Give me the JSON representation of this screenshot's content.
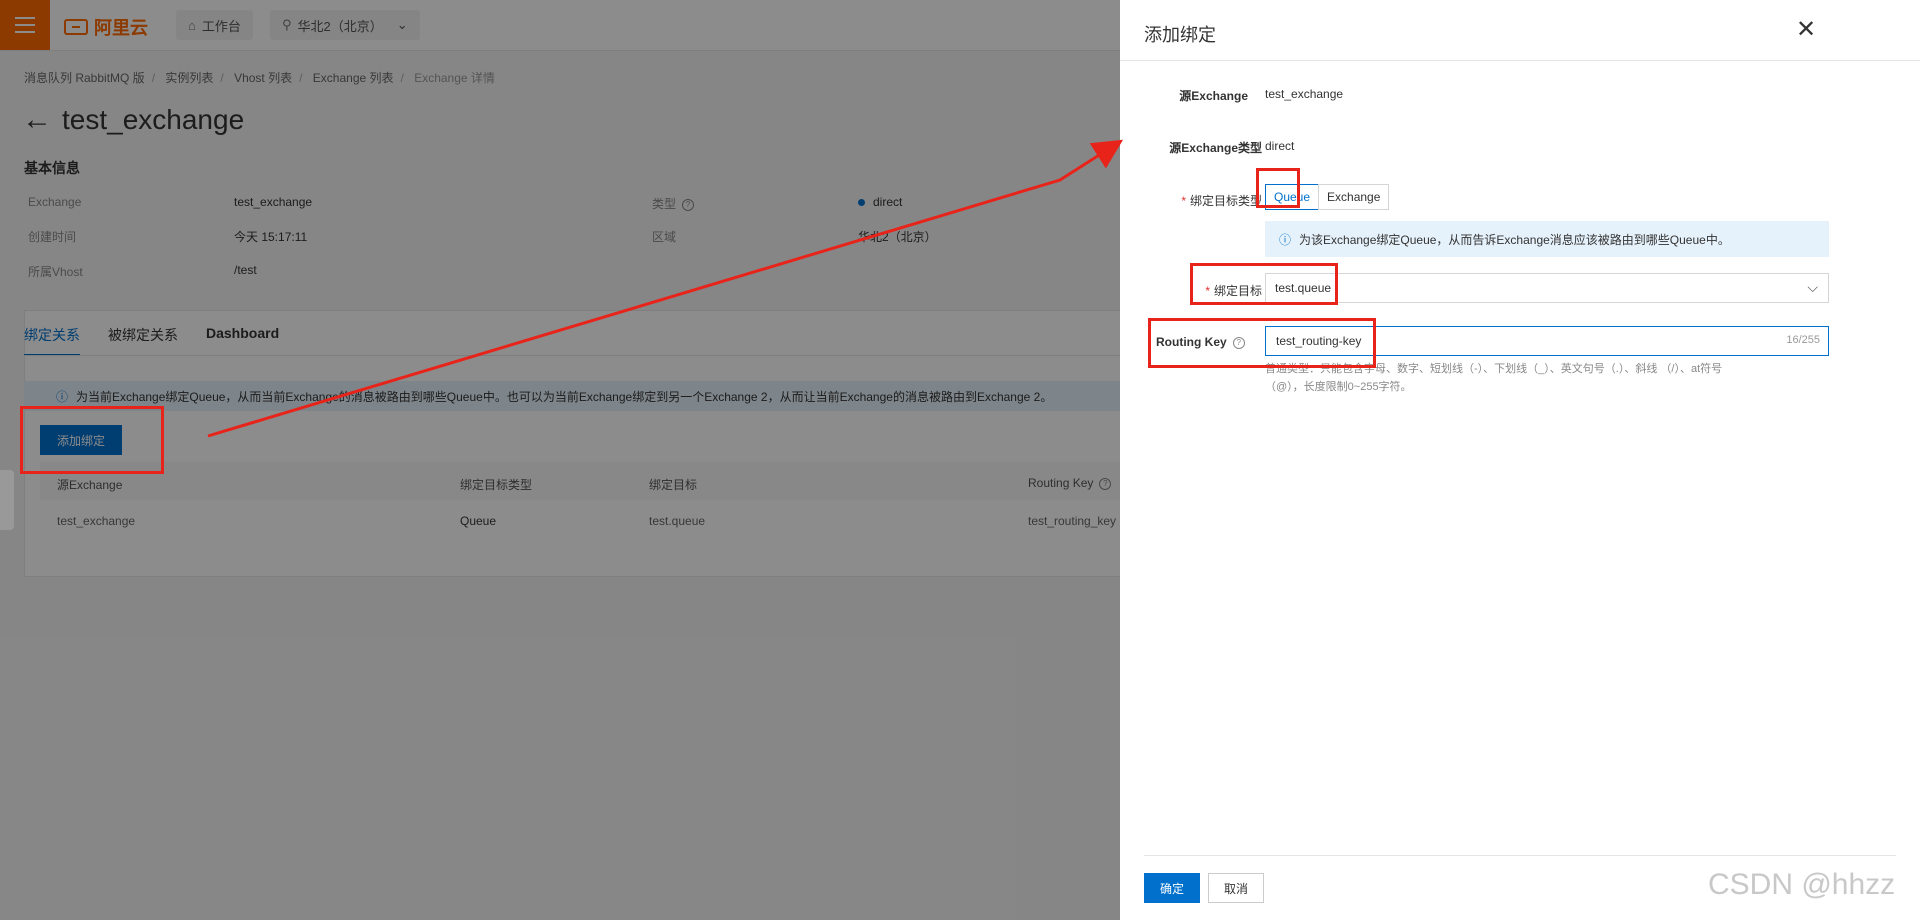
{
  "topbar": {
    "logo_text": "阿里云",
    "workbench": "工作台",
    "region": "华北2（北京）"
  },
  "breadcrumb": [
    "消息队列 RabbitMQ 版",
    "实例列表",
    "Vhost 列表",
    "Exchange 列表",
    "Exchange 详情"
  ],
  "page": {
    "title": "test_exchange",
    "basic_info_title": "基本信息",
    "info": {
      "exchange_label": "Exchange",
      "exchange_value": "test_exchange",
      "type_label": "类型",
      "type_value": "direct",
      "created_label": "创建时间",
      "created_value": "今天 15:17:11",
      "region_label": "区域",
      "region_value": "华北2（北京）",
      "vhost_label": "所属Vhost",
      "vhost_value": "/test"
    },
    "tabs": [
      "绑定关系",
      "被绑定关系",
      "Dashboard"
    ],
    "notice": "为当前Exchange绑定Queue，从而当前Exchange的消息被路由到哪些Queue中。也可以为当前Exchange绑定到另一个Exchange 2，从而让当前Exchange的消息被路由到Exchange 2。",
    "add_button": "添加绑定",
    "table": {
      "headers": [
        "源Exchange",
        "绑定目标类型",
        "绑定目标",
        "Routing Key"
      ],
      "rows": [
        [
          "test_exchange",
          "Queue",
          "test.queue",
          "test_routing_key"
        ]
      ]
    }
  },
  "drawer": {
    "title": "添加绑定",
    "source_exchange_label": "源Exchange",
    "source_exchange_value": "test_exchange",
    "source_type_label": "源Exchange类型",
    "source_type_value": "direct",
    "target_type_label": "绑定目标类型",
    "target_type_options": [
      "Queue",
      "Exchange"
    ],
    "target_type_selected": "Queue",
    "hint": "为该Exchange绑定Queue，从而告诉Exchange消息应该被路由到哪些Queue中。",
    "target_label": "绑定目标",
    "target_value": "test.queue",
    "routing_key_label": "Routing Key",
    "routing_key_value": "test_routing-key",
    "routing_key_counter": "16/255",
    "routing_key_help_1": "普通类型：只能包含字母、数字、短划线（-）、下划线（_）、英文句号（.）、斜线 （/）、at符号",
    "routing_key_help_2": "（@），长度限制0~255字符。",
    "ok_button": "确定",
    "cancel_button": "取消"
  },
  "watermark": "CSDN @hhzz",
  "colors": {
    "brand": "#ff6a00",
    "primary": "#0070cc",
    "annotation": "#e8231a"
  }
}
